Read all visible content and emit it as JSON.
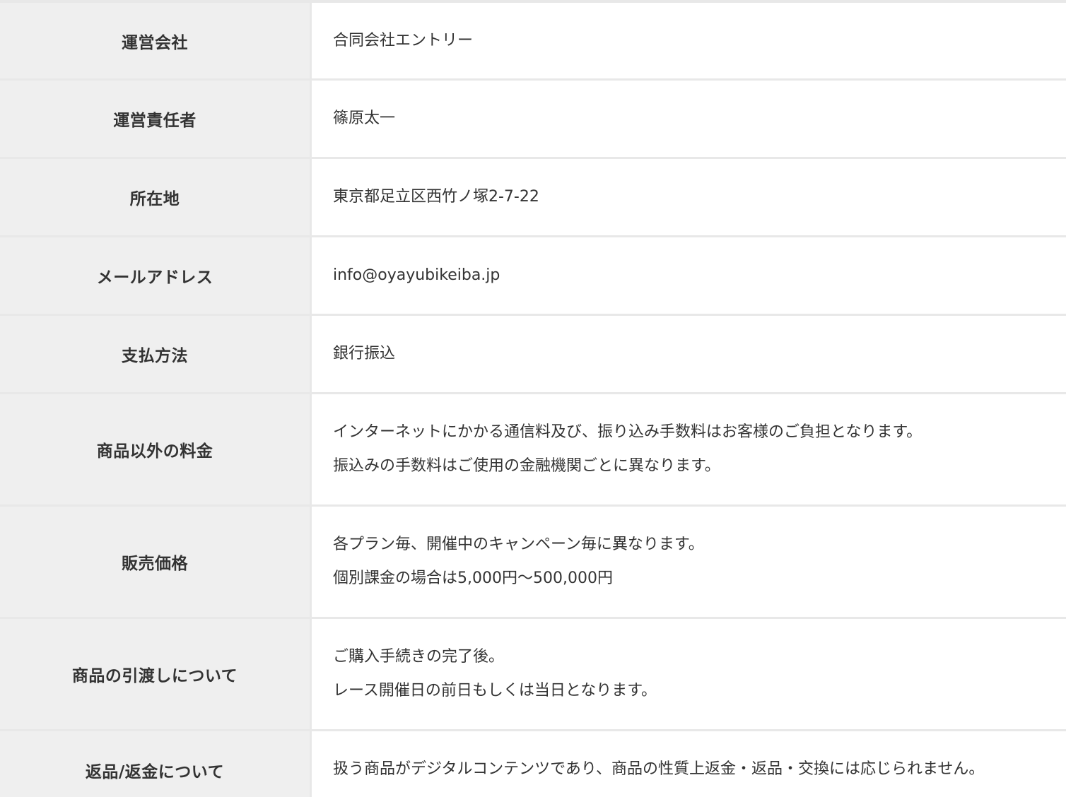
{
  "rows": [
    {
      "label": "運営会社",
      "lines": [
        "合同会社エントリー"
      ]
    },
    {
      "label": "運営責任者",
      "lines": [
        "篠原太一"
      ]
    },
    {
      "label": "所在地",
      "lines": [
        "東京都足立区西竹ノ塚2-7-22"
      ]
    },
    {
      "label": "メールアドレス",
      "lines": [
        "info@oyayubikeiba.jp"
      ]
    },
    {
      "label": "支払方法",
      "lines": [
        "銀行振込"
      ]
    },
    {
      "label": "商品以外の料金",
      "lines": [
        "インターネットにかかる通信料及び、振り込み手数料はお客様のご負担となります。",
        "振込みの手数料はご使用の金融機関ごとに異なります。"
      ]
    },
    {
      "label": "販売価格",
      "lines": [
        "各プラン毎、開催中のキャンペーン毎に異なります。",
        "個別課金の場合は5,000円～500,000円"
      ]
    },
    {
      "label": "商品の引渡しについて",
      "lines": [
        "ご購入手続きの完了後。",
        "レース開催日の前日もしくは当日となります。"
      ]
    },
    {
      "label": "返品/返金について",
      "lines": [
        "扱う商品がデジタルコンテンツであり、商品の性質上返金・返品・交換には応じられません。"
      ]
    }
  ]
}
